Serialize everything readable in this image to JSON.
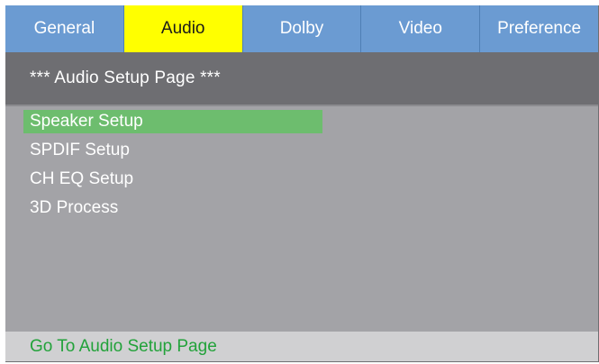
{
  "tabs": [
    {
      "label": "General",
      "active": false
    },
    {
      "label": "Audio",
      "active": true
    },
    {
      "label": "Dolby",
      "active": false
    },
    {
      "label": "Video",
      "active": false
    },
    {
      "label": "Preference",
      "active": false
    }
  ],
  "page_title": "*** Audio Setup Page ***",
  "menu": {
    "items": [
      {
        "label": "Speaker Setup",
        "selected": true
      },
      {
        "label": "SPDIF Setup",
        "selected": false
      },
      {
        "label": "CH EQ Setup",
        "selected": false
      },
      {
        "label": "3D Process",
        "selected": false
      }
    ]
  },
  "status": "Go To Audio Setup Page",
  "colors": {
    "tab_bg": "#6b9bd2",
    "tab_active": "#ffff00",
    "title_bg": "#6e6e72",
    "panel_bg": "#a3a3a7",
    "selected_bg": "#6dbd6e",
    "status_bg": "#d0d0d2",
    "status_text": "#22a23a"
  }
}
